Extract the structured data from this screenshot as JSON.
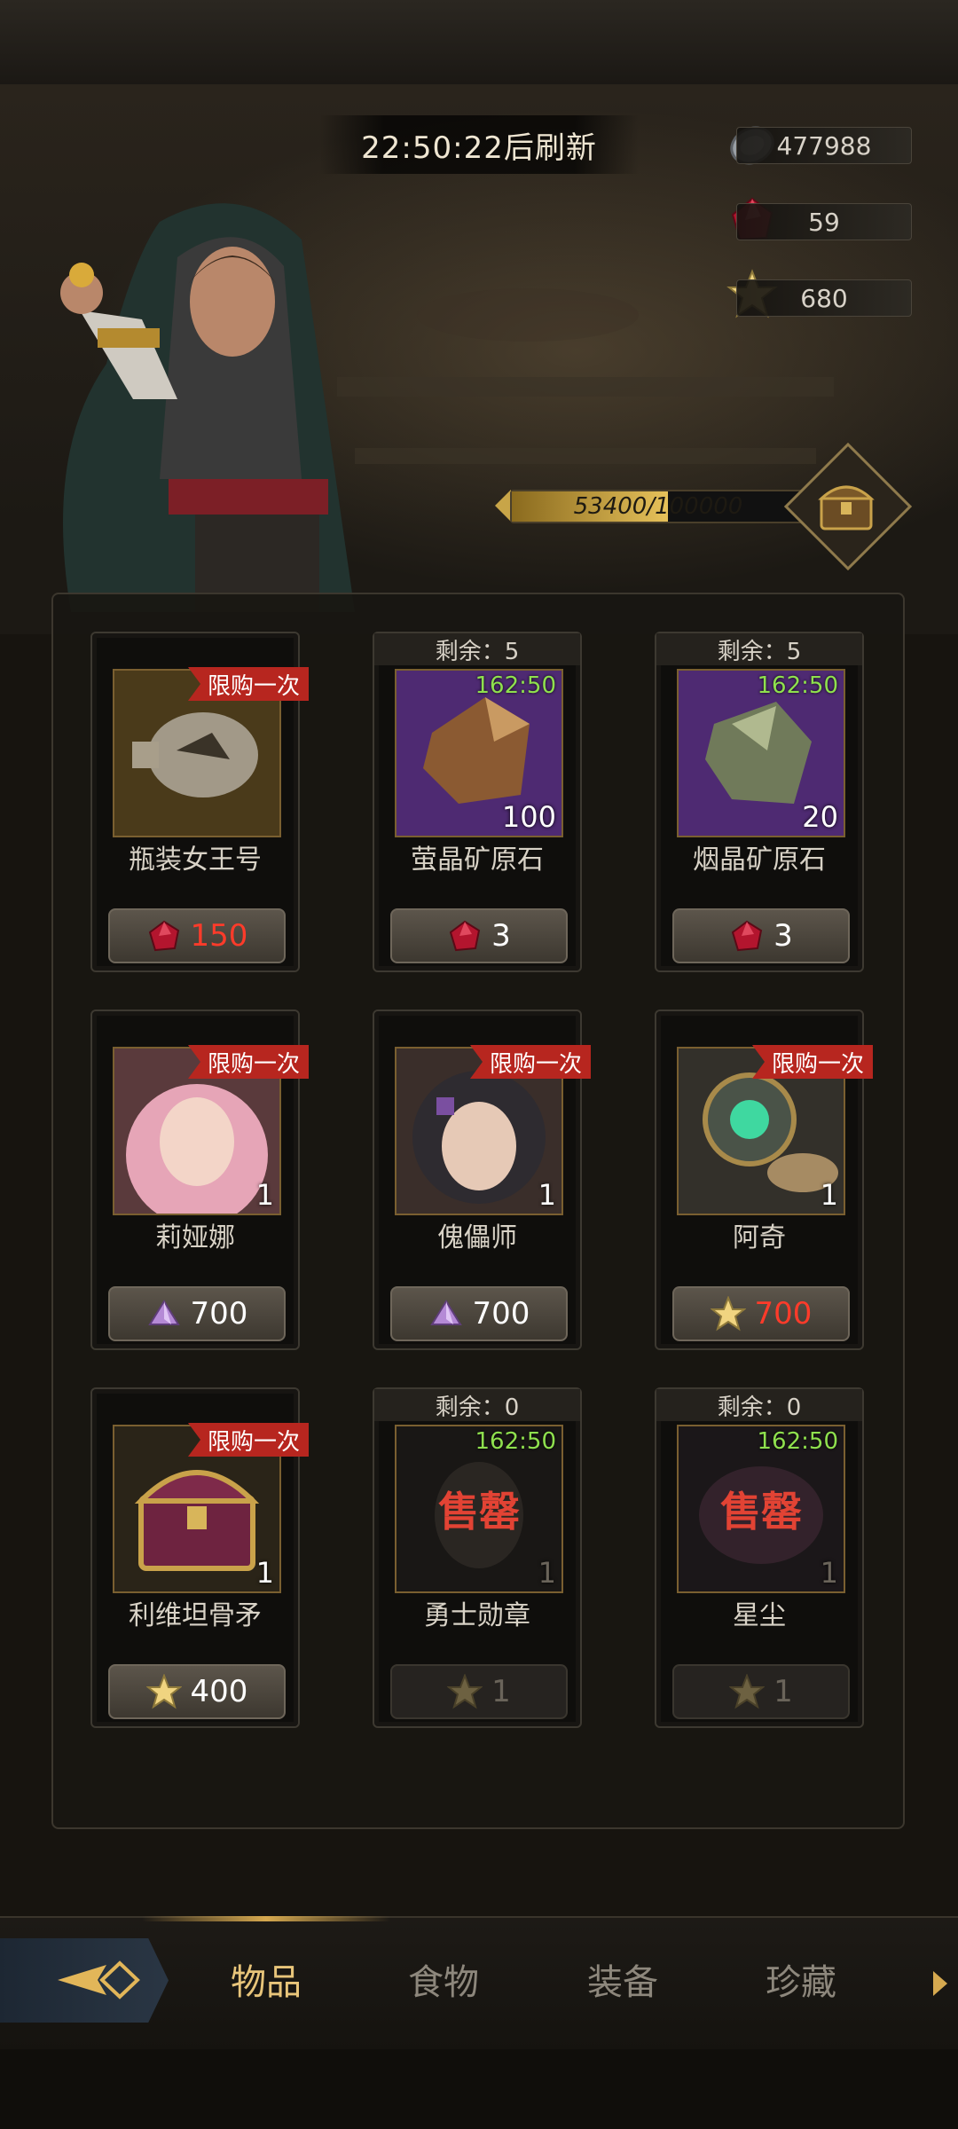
{
  "header": {
    "refresh_timer": "22:50:22后刷新"
  },
  "currencies": [
    {
      "icon": "silver-coin-icon",
      "value": "477988"
    },
    {
      "icon": "ruby-gem-icon",
      "value": "59"
    },
    {
      "icon": "gold-star-icon",
      "value": "680"
    }
  ],
  "progress": {
    "text": "53400/100000",
    "current": 53400,
    "max": 100000
  },
  "cards": [
    {
      "name": "瓶装女王号",
      "badge": "限购一次",
      "remaining": "",
      "timer": "",
      "qty": "",
      "price": "150",
      "currency_icon": "ruby-gem-icon",
      "price_color": "red",
      "thumb": "bottle"
    },
    {
      "name": "萤晶矿原石",
      "badge": "",
      "remaining": "剩余：5",
      "timer": "162:50",
      "qty": "100",
      "price": "3",
      "currency_icon": "ruby-gem-icon",
      "price_color": "white",
      "thumb": "ore-brown"
    },
    {
      "name": "烟晶矿原石",
      "badge": "",
      "remaining": "剩余：5",
      "timer": "162:50",
      "qty": "20",
      "price": "3",
      "currency_icon": "ruby-gem-icon",
      "price_color": "white",
      "thumb": "ore-green"
    },
    {
      "name": "莉娅娜",
      "badge": "限购一次",
      "remaining": "",
      "timer": "",
      "qty": "1",
      "price": "700",
      "currency_icon": "purple-crystal-icon",
      "price_color": "white",
      "thumb": "portrait-pink"
    },
    {
      "name": "傀儡师",
      "badge": "限购一次",
      "remaining": "",
      "timer": "",
      "qty": "1",
      "price": "700",
      "currency_icon": "purple-crystal-icon",
      "price_color": "white",
      "thumb": "portrait-dark"
    },
    {
      "name": "阿奇",
      "badge": "限购一次",
      "remaining": "",
      "timer": "",
      "qty": "1",
      "price": "700",
      "currency_icon": "gold-star-icon",
      "price_color": "red",
      "thumb": "mech"
    },
    {
      "name": "利维坦骨矛",
      "badge": "限购一次",
      "remaining": "",
      "timer": "",
      "qty": "1",
      "price": "400",
      "currency_icon": "gold-star-icon",
      "price_color": "white",
      "thumb": "chest"
    },
    {
      "name": "勇士勋章",
      "badge": "",
      "remaining": "剩余：0",
      "timer": "162:50",
      "qty": "1",
      "price": "1",
      "currency_icon": "gold-star-icon",
      "price_color": "dim",
      "thumb": "soldout",
      "soldout": "售罄"
    },
    {
      "name": "星尘",
      "badge": "",
      "remaining": "剩余：0",
      "timer": "162:50",
      "qty": "1",
      "price": "1",
      "currency_icon": "gold-star-icon",
      "price_color": "dim",
      "thumb": "soldout-pink",
      "soldout": "售罄"
    }
  ],
  "tabs": [
    {
      "label": "物品",
      "active": true
    },
    {
      "label": "食物",
      "active": false
    },
    {
      "label": "装备",
      "active": false
    },
    {
      "label": "珍藏",
      "active": false
    }
  ],
  "colors": {
    "accent_gold": "#e8c57a",
    "price_red": "#ff3b2a",
    "timer_green": "#8fe04e",
    "badge_red": "#b7261f"
  }
}
